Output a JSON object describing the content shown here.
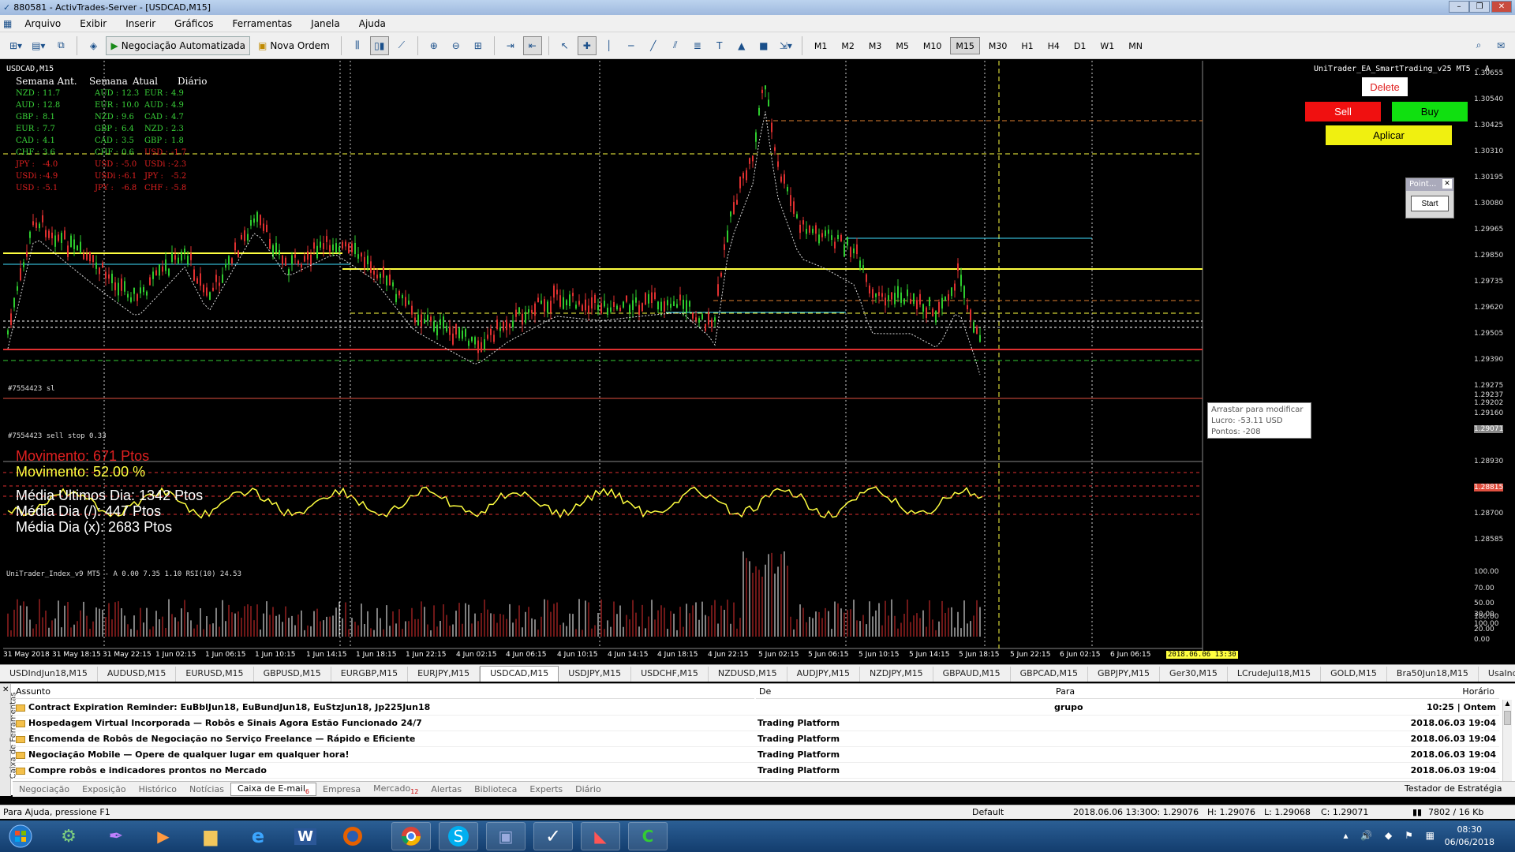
{
  "window": {
    "title": "880581 - ActivTrades-Server - [USDCAD,M15]"
  },
  "menu": [
    "Arquivo",
    "Exibir",
    "Inserir",
    "Gráficos",
    "Ferramentas",
    "Janela",
    "Ajuda"
  ],
  "toolbar": {
    "auto_trading": "Negociação Automatizada",
    "new_order": "Nova Ordem",
    "timeframes": [
      "M1",
      "M2",
      "M3",
      "M5",
      "M10",
      "M15",
      "M30",
      "H1",
      "H4",
      "D1",
      "W1",
      "MN"
    ],
    "active_timeframe": "M15"
  },
  "chart": {
    "symbol_title": "USDCAD,M15",
    "ea_title": "UniTrader_EA_SmartTrading_v25 MT5 - A",
    "strength_headers": [
      "Semana Ant.",
      "Semana",
      "Atual",
      "Diário"
    ],
    "strength_cols": [
      [
        {
          "t": "NZD :",
          "v": "11.7",
          "c": "#39d239"
        },
        {
          "t": "AUD :",
          "v": "12.8",
          "c": "#39d239"
        },
        {
          "t": "GBP :",
          "v": "8.1",
          "c": "#39d239"
        },
        {
          "t": "EUR :",
          "v": "7.7",
          "c": "#39d239"
        },
        {
          "t": "CAD :",
          "v": "4.1",
          "c": "#39d239"
        },
        {
          "t": "CHF :",
          "v": "3.6",
          "c": "#39d239"
        },
        {
          "t": "JPY :",
          "v": "-4.0",
          "c": "#e02020"
        },
        {
          "t": "USDi :",
          "v": "-4.9",
          "c": "#e02020"
        },
        {
          "t": "USD :",
          "v": "-5.1",
          "c": "#e02020"
        }
      ],
      [
        {
          "t": "AUD :",
          "v": "12.3",
          "c": "#39d239"
        },
        {
          "t": "EUR :",
          "v": "10.0",
          "c": "#39d239"
        },
        {
          "t": "NZD :",
          "v": "9.6",
          "c": "#39d239"
        },
        {
          "t": "GBP :",
          "v": "6.4",
          "c": "#39d239"
        },
        {
          "t": "CAD :",
          "v": "3.5",
          "c": "#39d239"
        },
        {
          "t": "CHF :",
          "v": "0.6",
          "c": "#39d239"
        },
        {
          "t": "USD :",
          "v": "-5.0",
          "c": "#e02020"
        },
        {
          "t": "USDi :",
          "v": "-6.1",
          "c": "#e02020"
        },
        {
          "t": "JPY :",
          "v": "-6.8",
          "c": "#e02020"
        }
      ],
      [
        {
          "t": "EUR :",
          "v": "4.9",
          "c": "#39d239"
        },
        {
          "t": "AUD :",
          "v": "4.9",
          "c": "#39d239"
        },
        {
          "t": "CAD :",
          "v": "4.7",
          "c": "#39d239"
        },
        {
          "t": "NZD :",
          "v": "2.3",
          "c": "#39d239"
        },
        {
          "t": "GBP :",
          "v": "1.8",
          "c": "#39d239"
        },
        {
          "t": "USD :",
          "v": "-1.7",
          "c": "#e02020"
        },
        {
          "t": "USDi :",
          "v": "-2.3",
          "c": "#e02020"
        },
        {
          "t": "JPY :",
          "v": "-5.2",
          "c": "#e02020"
        },
        {
          "t": "CHF :",
          "v": "-5.8",
          "c": "#e02020"
        }
      ]
    ],
    "order_label_1": "#7554423 sl",
    "order_label_2": "#7554423 sell stop 0.33",
    "movimento_ptos": "Movimento:    671   Ptos",
    "movimento_pct": "Movimento:    52.00 %",
    "media_ultimos": "Média Ultimos Dia: 1342   Ptos",
    "media_dia_slash": "Média Dia (/):       447     Ptos",
    "media_dia_x": "Média Dia (x):       2683   Ptos",
    "btn_delete": "Delete",
    "btn_sell": "Sell",
    "btn_buy": "Buy",
    "btn_apply": "Aplicar",
    "point_title": "Point...",
    "point_start": "Start",
    "tooltip": [
      "Arrastar para modificar",
      "Lucro: -53.11 USD",
      "Pontos: -208"
    ],
    "indicator_title": "UniTrader_Index_v9 MT5 - A 0.00 7.35 1.10 RSI(10) 24.53",
    "price_axis": [
      "1.30655",
      "1.30540",
      "1.30425",
      "1.30310",
      "1.30195",
      "1.30080",
      "1.29965",
      "1.29850",
      "1.29735",
      "1.29620",
      "1.29505",
      "1.29390",
      "1.29275",
      "1.29237",
      "1.29202",
      "1.29160",
      "1.29071",
      "1.28930",
      "1.28815",
      "1.28700",
      "1.28585"
    ],
    "ind_axis": [
      "100.00",
      "70.00",
      "50.00",
      "30.00",
      "180.00",
      "100.00",
      "20.00",
      "0.00"
    ],
    "time_axis": [
      "31 May 2018",
      "31 May 18:15",
      "31 May 22:15",
      "1 Jun 02:15",
      "1 Jun 06:15",
      "1 Jun 10:15",
      "1 Jun 14:15",
      "1 Jun 18:15",
      "1 Jun 22:15",
      "4 Jun 02:15",
      "4 Jun 06:15",
      "4 Jun 10:15",
      "4 Jun 14:15",
      "4 Jun 18:15",
      "4 Jun 22:15",
      "5 Jun 02:15",
      "5 Jun 06:15",
      "5 Jun 10:15",
      "5 Jun 14:15",
      "5 Jun 18:15",
      "5 Jun 22:15",
      "6 Jun 02:15",
      "6 Jun 06:15"
    ],
    "time_cursor": "2018.06.06 13:30",
    "colors": {
      "bull": "#2ecc2e",
      "bear": "#e03030",
      "yellow": "#ffff40",
      "cyan": "#40e0ff",
      "orange": "#e08030"
    }
  },
  "symbol_tabs": [
    "USDIndJun18,M15",
    "AUDUSD,M15",
    "EURUSD,M15",
    "GBPUSD,M15",
    "EURGBP,M15",
    "EURJPY,M15",
    "USDCAD,M15",
    "USDJPY,M15",
    "USDCHF,M15",
    "NZDUSD,M15",
    "AUDJPY,M15",
    "NZDJPY,M15",
    "GBPAUD,M15",
    "GBPCAD,M15",
    "GBPJPY,M15",
    "Ger30,M15",
    "LCrudeJul18,M15",
    "GOLD,M15",
    "Bra50Jun18,M15",
    "UsaInd,M"
  ],
  "active_symbol_tab": "USDCAD,M15",
  "mail": {
    "side_label": "Caixa de Ferramentas",
    "headers": {
      "subject": "Assunto",
      "from": "De",
      "to": "Para",
      "time": "Horário"
    },
    "rows": [
      {
        "subject": "Contract Expiration Reminder: EuBblJun18, EuBundJun18, EuStzJun18, Jp225Jun18",
        "from": "",
        "to": "grupo",
        "time": "10:25 | Ontem"
      },
      {
        "subject": "Hospedagem Virtual Incorporada — Robôs e Sinais Agora Estão Funcionado 24/7",
        "from": "Trading Platform",
        "to": "",
        "time": "2018.06.03 19:04"
      },
      {
        "subject": "Encomenda de Robôs de Negociação no Serviço Freelance — Rápido e Eficiente",
        "from": "Trading Platform",
        "to": "",
        "time": "2018.06.03 19:04"
      },
      {
        "subject": "Negociação Mobile — Opere de qualquer lugar em qualquer hora!",
        "from": "Trading Platform",
        "to": "",
        "time": "2018.06.03 19:04"
      },
      {
        "subject": "Compre robôs e indicadores prontos no Mercado",
        "from": "Trading Platform",
        "to": "",
        "time": "2018.06.03 19:04"
      }
    ]
  },
  "bottom_tabs": [
    {
      "label": "Negociação",
      "badge": ""
    },
    {
      "label": "Exposição",
      "badge": ""
    },
    {
      "label": "Histórico",
      "badge": ""
    },
    {
      "label": "Notícias",
      "badge": ""
    },
    {
      "label": "Caixa de E-mail",
      "badge": "6"
    },
    {
      "label": "Empresa",
      "badge": ""
    },
    {
      "label": "Mercado",
      "badge": "12"
    },
    {
      "label": "Alertas",
      "badge": ""
    },
    {
      "label": "Biblioteca",
      "badge": ""
    },
    {
      "label": "Experts",
      "badge": ""
    },
    {
      "label": "Diário",
      "badge": ""
    }
  ],
  "active_bottom_tab": "Caixa de E-mail",
  "strategy_tester": "Testador de Estratégia",
  "status": {
    "help": "Para Ajuda, pressione F1",
    "profile": "Default",
    "datetime": "2018.06.06 13:30",
    "open": "O: 1.29076",
    "high": "H: 1.29076",
    "low": "L: 1.29068",
    "close": "C: 1.29071",
    "traffic": "7802 / 16 Kb"
  },
  "clock": {
    "time": "08:30",
    "date": "06/06/2018"
  }
}
